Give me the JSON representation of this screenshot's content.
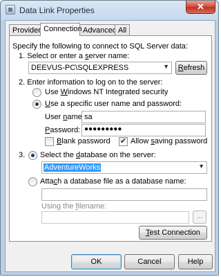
{
  "window": {
    "title": "Data Link Properties",
    "close_glyph": "✕"
  },
  "tabs": [
    {
      "label": "Provider"
    },
    {
      "label": "Connection"
    },
    {
      "label": "Advanced"
    },
    {
      "label": "All"
    }
  ],
  "connection": {
    "intro": "Specify the following to connect to SQL Server data:",
    "step1": {
      "num": "1.",
      "pre": "Select or enter a ",
      "ul": "s",
      "post": "erver name:",
      "server_value": "DEEVUS-PC\\SQLEXPRESS",
      "refresh": {
        "ul": "R",
        "rest": "efresh"
      }
    },
    "step2": {
      "num": "2.",
      "label": "Enter information to log on to the server:",
      "nt": {
        "pre": "Use ",
        "ul": "W",
        "post": "indows NT Integrated security",
        "checked": false
      },
      "specific": {
        "pre": "",
        "ul": "U",
        "post": "se a specific user name and password:",
        "checked": true
      },
      "username": {
        "pre": "User ",
        "ul": "n",
        "post": "ame:",
        "value": "sa"
      },
      "password": {
        "ul": "P",
        "post": "assword:",
        "value": "●●●●●●●●●"
      },
      "blank": {
        "ul": "B",
        "post": "lank password",
        "checked": false
      },
      "allow": {
        "pre": "Allow ",
        "ul": "s",
        "post": "aving password",
        "checked": true
      }
    },
    "step3": {
      "num": "3.",
      "select_db": {
        "pre": "Select the ",
        "ul": "d",
        "post": "atabase on the server:",
        "checked": true
      },
      "db_value": "AdventureWorks",
      "attach": {
        "pre": "Atta",
        "ul": "c",
        "post": "h a database file as a database name:",
        "checked": false
      },
      "attach_name_value": "",
      "filename": {
        "pre": "Using the ",
        "ul": "f",
        "post": "ilename:"
      },
      "filename_value": "",
      "browse_label": "..."
    },
    "test": {
      "ul": "T",
      "rest": "est Connection"
    }
  },
  "footer": {
    "ok": "OK",
    "cancel": "Cancel",
    "help": "Help"
  }
}
